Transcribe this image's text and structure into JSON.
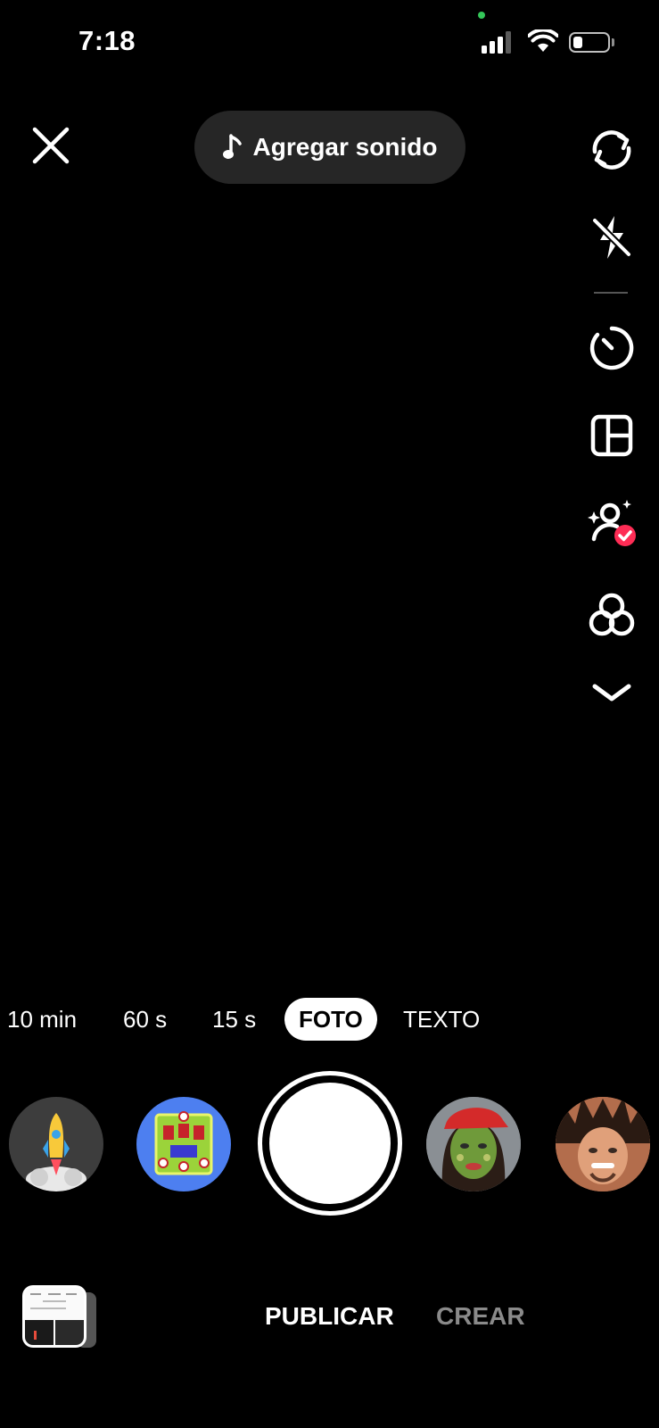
{
  "status_bar": {
    "time": "7:18"
  },
  "top_bar": {
    "sound_label": "Agregar sonido"
  },
  "right_rail": {
    "icons": [
      "flip-camera-icon",
      "flash-off-icon",
      "timer-icon",
      "layout-icon",
      "beauty-icon",
      "filters-icon",
      "chevron-down-icon"
    ]
  },
  "modes": {
    "items": [
      "10 min",
      "60 s",
      "15 s",
      "FOTO",
      "TEXTO"
    ],
    "selected": "FOTO"
  },
  "effects": {
    "items": [
      "rocket-effect",
      "board-game-effect",
      "green-face-effect",
      "wild-hair-effect"
    ]
  },
  "bottom_tabs": {
    "publicar": "PUBLICAR",
    "crear": "CREAR",
    "selected": "PUBLICAR"
  },
  "colors": {
    "background": "#000000",
    "pill": "#262626",
    "beauty_badge": "#fe2c55",
    "inactive_tab": "#8a8a8a"
  }
}
